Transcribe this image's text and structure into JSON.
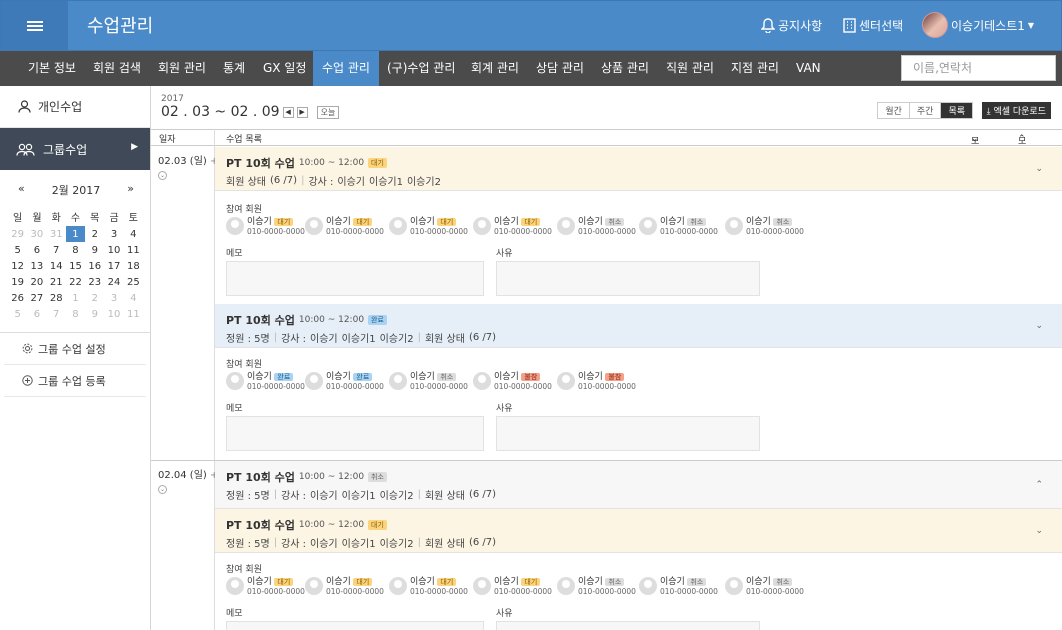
{
  "header": {
    "title": "수업관리",
    "notice": "공지사항",
    "center_select": "센터선택",
    "user": "이승기테스트1"
  },
  "nav": {
    "items": [
      "기본 정보",
      "회원 검색",
      "회원 관리",
      "통계",
      "GX 일정",
      "수업 관리",
      "(구)수업 관리",
      "회계 관리",
      "상담 관리",
      "상품 관리",
      "직원 관리",
      "지점 관리",
      "VAN"
    ],
    "active": "수업 관리",
    "search_placeholder": "이름,연락처"
  },
  "sidebar": {
    "personal": "개인수업",
    "group": "그룹수업",
    "calendar": {
      "prev": "«",
      "next": "»",
      "month": "2월 2017",
      "weekdays": [
        "일",
        "월",
        "화",
        "수",
        "목",
        "금",
        "토"
      ],
      "weeks": [
        [
          "29",
          "30",
          "31",
          "1",
          "2",
          "3",
          "4"
        ],
        [
          "5",
          "6",
          "7",
          "8",
          "9",
          "10",
          "11"
        ],
        [
          "12",
          "13",
          "14",
          "15",
          "16",
          "17",
          "18"
        ],
        [
          "19",
          "20",
          "21",
          "22",
          "23",
          "24",
          "25"
        ],
        [
          "26",
          "27",
          "28",
          "1",
          "2",
          "3",
          "4"
        ],
        [
          "5",
          "6",
          "7",
          "8",
          "9",
          "10",
          "11"
        ]
      ],
      "selected": "1"
    },
    "settings": "그룹 수업 설정",
    "register": "그룹 수업 등록"
  },
  "toolbar": {
    "year": "2017",
    "range": "02 . 03 ~ 02 . 09",
    "today": "오늘",
    "views": [
      "월간",
      "주간",
      "목록"
    ],
    "excel": "엑셀 다운로드"
  },
  "columns": {
    "date": "일자",
    "list": "수업 목록",
    "expand_all": "모두 열림",
    "collapse_all": "모두 닫힘"
  },
  "common": {
    "participants": "참여 회원",
    "memo": "메모",
    "reason": "사유",
    "phone": "010-0000-0000",
    "name": "이승기",
    "capacity": "정원 : 5명",
    "coach_label": "강사 :",
    "coaches": [
      "이승기",
      "이승기1",
      "이승기2"
    ],
    "member_state": "회원 상태",
    "member_state_count": "(6 /7)"
  },
  "days": [
    {
      "date": "02.03 (일)"
    },
    {
      "date": "02.04 (일)"
    }
  ],
  "classes": [
    {
      "title": "PT 10회 수업",
      "time": "10:00 ~ 12:00",
      "status": "대기",
      "members": [
        "대기",
        "대기",
        "대기",
        "대기",
        "취소",
        "취소",
        "취소"
      ]
    },
    {
      "title": "PT 10회 수업",
      "time": "10:00 ~ 12:00",
      "status": "완료",
      "members": [
        "완료",
        "완료",
        "취소",
        "불참",
        "불참"
      ]
    },
    {
      "title": "PT 10회 수업",
      "time": "10:00 ~ 12:00",
      "status": "취소"
    },
    {
      "title": "PT 10회 수업",
      "time": "10:00 ~ 12:00",
      "status": "대기",
      "members": [
        "대기",
        "대기",
        "대기",
        "대기",
        "취소",
        "취소",
        "취소"
      ]
    }
  ],
  "colors": {
    "header": "#4a8ac9",
    "nav": "#4b4b4b",
    "sidebar_active": "#3f4957",
    "wait_bg": "#fdf5e4",
    "done_bg": "#e6eef7"
  }
}
